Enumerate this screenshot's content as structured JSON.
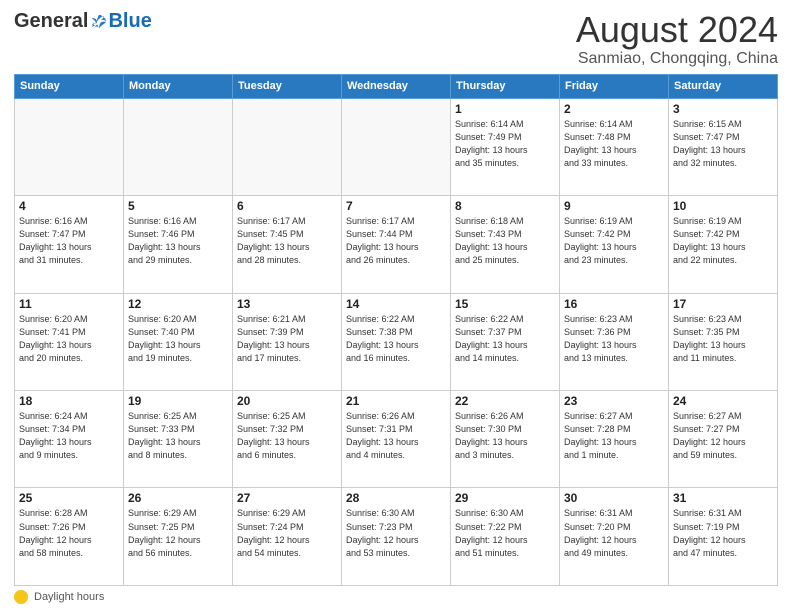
{
  "header": {
    "logo_general": "General",
    "logo_blue": "Blue",
    "month_title": "August 2024",
    "subtitle": "Sanmiao, Chongqing, China"
  },
  "days_of_week": [
    "Sunday",
    "Monday",
    "Tuesday",
    "Wednesday",
    "Thursday",
    "Friday",
    "Saturday"
  ],
  "footer_label": "Daylight hours",
  "weeks": [
    [
      {
        "day": "",
        "info": ""
      },
      {
        "day": "",
        "info": ""
      },
      {
        "day": "",
        "info": ""
      },
      {
        "day": "",
        "info": ""
      },
      {
        "day": "1",
        "info": "Sunrise: 6:14 AM\nSunset: 7:49 PM\nDaylight: 13 hours\nand 35 minutes."
      },
      {
        "day": "2",
        "info": "Sunrise: 6:14 AM\nSunset: 7:48 PM\nDaylight: 13 hours\nand 33 minutes."
      },
      {
        "day": "3",
        "info": "Sunrise: 6:15 AM\nSunset: 7:47 PM\nDaylight: 13 hours\nand 32 minutes."
      }
    ],
    [
      {
        "day": "4",
        "info": "Sunrise: 6:16 AM\nSunset: 7:47 PM\nDaylight: 13 hours\nand 31 minutes."
      },
      {
        "day": "5",
        "info": "Sunrise: 6:16 AM\nSunset: 7:46 PM\nDaylight: 13 hours\nand 29 minutes."
      },
      {
        "day": "6",
        "info": "Sunrise: 6:17 AM\nSunset: 7:45 PM\nDaylight: 13 hours\nand 28 minutes."
      },
      {
        "day": "7",
        "info": "Sunrise: 6:17 AM\nSunset: 7:44 PM\nDaylight: 13 hours\nand 26 minutes."
      },
      {
        "day": "8",
        "info": "Sunrise: 6:18 AM\nSunset: 7:43 PM\nDaylight: 13 hours\nand 25 minutes."
      },
      {
        "day": "9",
        "info": "Sunrise: 6:19 AM\nSunset: 7:42 PM\nDaylight: 13 hours\nand 23 minutes."
      },
      {
        "day": "10",
        "info": "Sunrise: 6:19 AM\nSunset: 7:42 PM\nDaylight: 13 hours\nand 22 minutes."
      }
    ],
    [
      {
        "day": "11",
        "info": "Sunrise: 6:20 AM\nSunset: 7:41 PM\nDaylight: 13 hours\nand 20 minutes."
      },
      {
        "day": "12",
        "info": "Sunrise: 6:20 AM\nSunset: 7:40 PM\nDaylight: 13 hours\nand 19 minutes."
      },
      {
        "day": "13",
        "info": "Sunrise: 6:21 AM\nSunset: 7:39 PM\nDaylight: 13 hours\nand 17 minutes."
      },
      {
        "day": "14",
        "info": "Sunrise: 6:22 AM\nSunset: 7:38 PM\nDaylight: 13 hours\nand 16 minutes."
      },
      {
        "day": "15",
        "info": "Sunrise: 6:22 AM\nSunset: 7:37 PM\nDaylight: 13 hours\nand 14 minutes."
      },
      {
        "day": "16",
        "info": "Sunrise: 6:23 AM\nSunset: 7:36 PM\nDaylight: 13 hours\nand 13 minutes."
      },
      {
        "day": "17",
        "info": "Sunrise: 6:23 AM\nSunset: 7:35 PM\nDaylight: 13 hours\nand 11 minutes."
      }
    ],
    [
      {
        "day": "18",
        "info": "Sunrise: 6:24 AM\nSunset: 7:34 PM\nDaylight: 13 hours\nand 9 minutes."
      },
      {
        "day": "19",
        "info": "Sunrise: 6:25 AM\nSunset: 7:33 PM\nDaylight: 13 hours\nand 8 minutes."
      },
      {
        "day": "20",
        "info": "Sunrise: 6:25 AM\nSunset: 7:32 PM\nDaylight: 13 hours\nand 6 minutes."
      },
      {
        "day": "21",
        "info": "Sunrise: 6:26 AM\nSunset: 7:31 PM\nDaylight: 13 hours\nand 4 minutes."
      },
      {
        "day": "22",
        "info": "Sunrise: 6:26 AM\nSunset: 7:30 PM\nDaylight: 13 hours\nand 3 minutes."
      },
      {
        "day": "23",
        "info": "Sunrise: 6:27 AM\nSunset: 7:28 PM\nDaylight: 13 hours\nand 1 minute."
      },
      {
        "day": "24",
        "info": "Sunrise: 6:27 AM\nSunset: 7:27 PM\nDaylight: 12 hours\nand 59 minutes."
      }
    ],
    [
      {
        "day": "25",
        "info": "Sunrise: 6:28 AM\nSunset: 7:26 PM\nDaylight: 12 hours\nand 58 minutes."
      },
      {
        "day": "26",
        "info": "Sunrise: 6:29 AM\nSunset: 7:25 PM\nDaylight: 12 hours\nand 56 minutes."
      },
      {
        "day": "27",
        "info": "Sunrise: 6:29 AM\nSunset: 7:24 PM\nDaylight: 12 hours\nand 54 minutes."
      },
      {
        "day": "28",
        "info": "Sunrise: 6:30 AM\nSunset: 7:23 PM\nDaylight: 12 hours\nand 53 minutes."
      },
      {
        "day": "29",
        "info": "Sunrise: 6:30 AM\nSunset: 7:22 PM\nDaylight: 12 hours\nand 51 minutes."
      },
      {
        "day": "30",
        "info": "Sunrise: 6:31 AM\nSunset: 7:20 PM\nDaylight: 12 hours\nand 49 minutes."
      },
      {
        "day": "31",
        "info": "Sunrise: 6:31 AM\nSunset: 7:19 PM\nDaylight: 12 hours\nand 47 minutes."
      }
    ]
  ]
}
